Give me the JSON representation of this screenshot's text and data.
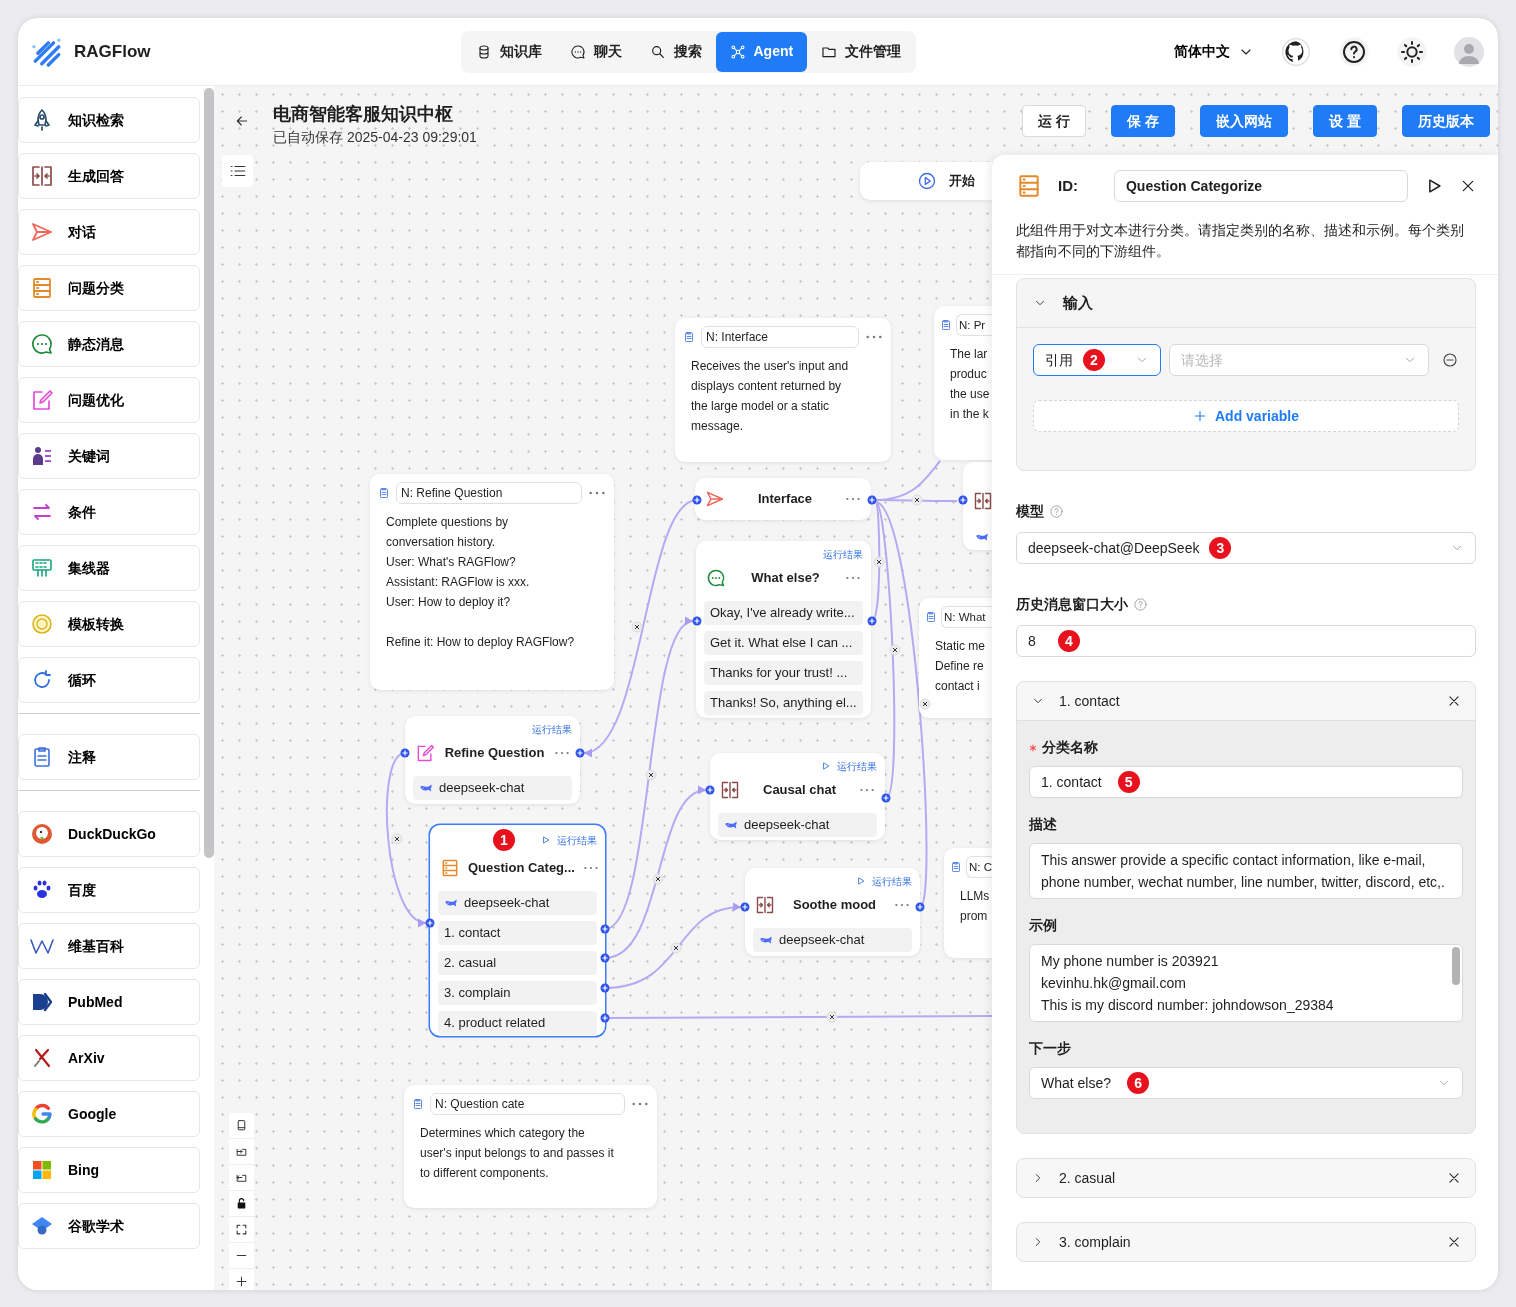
{
  "brand": {
    "name": "RAGFlow"
  },
  "nav": [
    {
      "label": "知识库",
      "selected": false
    },
    {
      "label": "聊天",
      "selected": false
    },
    {
      "label": "搜索",
      "selected": false
    },
    {
      "label": "Agent",
      "selected": true
    },
    {
      "label": "文件管理",
      "selected": false
    }
  ],
  "language": "简体中文",
  "sidebar": {
    "components": [
      {
        "label": "知识检索"
      },
      {
        "label": "生成回答"
      },
      {
        "label": "对话"
      },
      {
        "label": "问题分类"
      },
      {
        "label": "静态消息"
      },
      {
        "label": "问题优化"
      },
      {
        "label": "关键词"
      },
      {
        "label": "条件"
      },
      {
        "label": "集线器"
      },
      {
        "label": "模板转换"
      },
      {
        "label": "循环"
      }
    ],
    "notes": [
      {
        "label": "注释"
      }
    ],
    "tools": [
      {
        "label": "DuckDuckGo"
      },
      {
        "label": "百度"
      },
      {
        "label": "维基百科"
      },
      {
        "label": "PubMed"
      },
      {
        "label": "ArXiv"
      },
      {
        "label": "Google"
      },
      {
        "label": "Bing"
      },
      {
        "label": "谷歌学术"
      }
    ]
  },
  "flow": {
    "title": "电商智能客服知识中枢",
    "saved": "已自动保存 2025-04-23 09:29:01",
    "actions": [
      {
        "label": "运 行",
        "kind": "outline"
      },
      {
        "label": "保 存",
        "kind": "primary"
      },
      {
        "label": "嵌入网站",
        "kind": "primary"
      },
      {
        "label": "设 置",
        "kind": "primary"
      },
      {
        "label": "历史版本",
        "kind": "primary"
      }
    ]
  },
  "canvas": {
    "items": [
      {
        "kind": "begin",
        "title": "开始",
        "selected": false
      },
      {
        "kind": "note",
        "title": "N: Interface",
        "text": "Receives the user's input and\ndisplays content returned by\nthe large model or a static\nmessage.",
        "selected": false
      },
      {
        "kind": "note",
        "title": "N: Pr",
        "text": "The lar\nproduc\nthe use\nin the k",
        "selected": false
      },
      {
        "kind": "note",
        "title": "N: Refine Question",
        "text": "Complete questions by\nconversation history.\nUser: What's RAGFlow?\nAssistant: RAGFlow is xxx.\nUser: How to deploy it?\n\nRefine it: How to deploy RAGFlow?",
        "selected": false
      },
      {
        "kind": "interface",
        "title": "Interface",
        "selected": false
      },
      {
        "kind": "partial",
        "selected": false
      },
      {
        "kind": "message",
        "title": "What else?",
        "result_link": "运行结果",
        "run_icon": false,
        "items": [
          "Okay, I've already write...",
          "Get it. What else I can ...",
          "Thanks for your trust! ...",
          "Thanks! So, anything el..."
        ],
        "selected": false
      },
      {
        "kind": "note",
        "title": "N: What",
        "text": "Static me\nDefine re\ncontact i",
        "selected": false
      },
      {
        "kind": "rewrite",
        "title": "Refine Question",
        "result_link": "运行结果",
        "run_icon": false,
        "model": "deepseek-chat",
        "selected": false
      },
      {
        "kind": "generate",
        "title": "Causal chat",
        "result_link": "运行结果",
        "run_icon": true,
        "model": "deepseek-chat",
        "selected": false
      },
      {
        "kind": "categorize",
        "title": "Question Categ...",
        "marker": "1",
        "result_link": "运行结果",
        "run_icon": true,
        "model": "deepseek-chat",
        "items": [
          "1. contact",
          "2. casual",
          "3. complain",
          "4. product related"
        ],
        "selected": true
      },
      {
        "kind": "note",
        "title": "N: C",
        "text": "LLMs\nprom",
        "selected": false
      },
      {
        "kind": "generate",
        "title": "Soothe mood",
        "result_link": "运行结果",
        "run_icon": true,
        "model": "deepseek-chat",
        "selected": false
      },
      {
        "kind": "note",
        "title": "N: Question cate",
        "text": "Determines which category the\nuser's input belongs to and passes it\nto different components.",
        "selected": false
      }
    ]
  },
  "panel": {
    "id_label": "ID:",
    "id_value": "Question Categorize",
    "description": "此组件用于对文本进行分类。请指定类别的名称、描述和示例。每个类别都指向不同的下游组件。",
    "input": {
      "title": "输入",
      "expanded": true,
      "source": "引用",
      "source_marker": "2",
      "source_focused": true,
      "variable_placeholder": "请选择",
      "add_label": "Add variable"
    },
    "model": {
      "label": "模型",
      "value": "deepseek-chat@DeepSeek",
      "marker": "3"
    },
    "history": {
      "label": "历史消息窗口大小",
      "value": "8",
      "marker": "4"
    },
    "categories": [
      {
        "title": "1. contact",
        "expanded": true,
        "name_label": "分类名称",
        "name_required": true,
        "name": "1. contact",
        "name_marker": "5",
        "desc_label": "描述",
        "description": "This answer provide a specific contact information, like e-mail, phone number, wechat number, line number, twitter, discord, etc,.",
        "examples_label": "示例",
        "examples": "My phone number is 203921\nkevinhu.hk@gmail.com\nThis is my discord number: johndowson_29384",
        "next_label": "下一步",
        "next": "What else?",
        "next_marker": "6"
      },
      {
        "title": "2. casual",
        "expanded": false
      },
      {
        "title": "3. complain",
        "expanded": false
      }
    ]
  }
}
